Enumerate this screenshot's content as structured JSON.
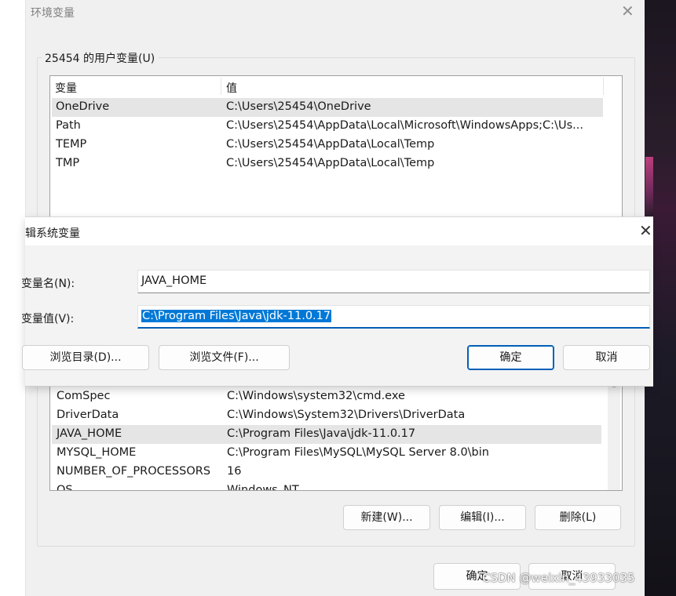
{
  "env_window": {
    "title": "环境变量",
    "user_group_label": "25454 的用户变量(U)",
    "user_list": {
      "headers": [
        "变量",
        "值"
      ],
      "rows": [
        {
          "name": "OneDrive",
          "value": "C:\\Users\\25454\\OneDrive"
        },
        {
          "name": "Path",
          "value": "C:\\Users\\25454\\AppData\\Local\\Microsoft\\WindowsApps;C:\\Us..."
        },
        {
          "name": "TEMP",
          "value": "C:\\Users\\25454\\AppData\\Local\\Temp"
        },
        {
          "name": "TMP",
          "value": "C:\\Users\\25454\\AppData\\Local\\Temp"
        }
      ]
    },
    "system_list": {
      "rows": [
        {
          "name": "ComSpec",
          "value": "C:\\Windows\\system32\\cmd.exe"
        },
        {
          "name": "DriverData",
          "value": "C:\\Windows\\System32\\Drivers\\DriverData"
        },
        {
          "name": "JAVA_HOME",
          "value": "C:\\Program Files\\Java\\jdk-11.0.17"
        },
        {
          "name": "MYSQL_HOME",
          "value": "C:\\Program Files\\MySQL\\MySQL Server 8.0\\bin"
        },
        {
          "name": "NUMBER_OF_PROCESSORS",
          "value": "16"
        },
        {
          "name": "OS",
          "value": "Windows_NT"
        }
      ]
    },
    "system_buttons": {
      "new": "新建(W)...",
      "edit": "编辑(I)...",
      "delete": "删除(L)"
    },
    "footer_buttons": {
      "ok": "确定",
      "cancel": "取消"
    }
  },
  "edit_dialog": {
    "title": "辑系统变量",
    "name_label": "变量名(N):",
    "name_value": "JAVA_HOME",
    "value_label": "变量值(V):",
    "value_value": "C:\\Program Files\\Java\\jdk-11.0.17",
    "buttons": {
      "browse_dir": "浏览目录(D)...",
      "browse_file": "浏览文件(F)...",
      "ok": "确定",
      "cancel": "取消"
    }
  },
  "watermark": "CSDN @weixin_43933035",
  "colors": {
    "accent": "#005fb8",
    "selection": "#0078d7",
    "window_bg": "#f0f0f0"
  }
}
